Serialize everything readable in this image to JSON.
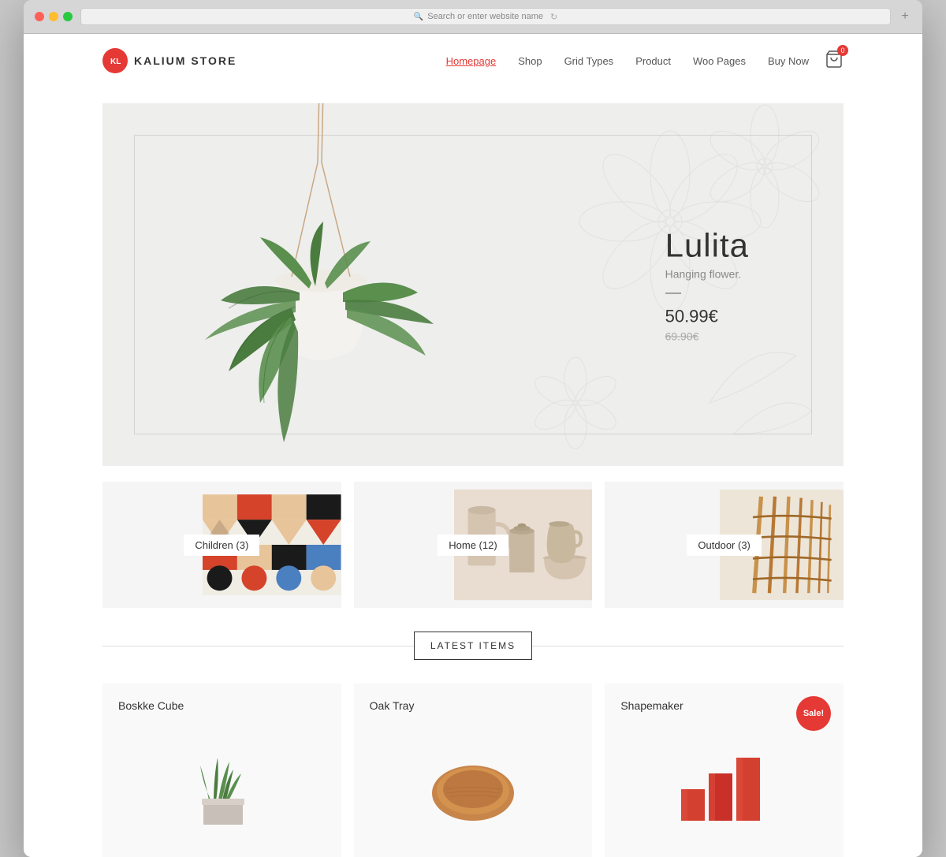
{
  "browser": {
    "address_placeholder": "Search or enter website name",
    "new_tab_label": "+"
  },
  "header": {
    "logo_text": "KALIUM STORE",
    "logo_initials": "KL",
    "nav": [
      {
        "label": "Homepage",
        "active": true
      },
      {
        "label": "Shop",
        "active": false
      },
      {
        "label": "Grid Types",
        "active": false
      },
      {
        "label": "Product",
        "active": false
      },
      {
        "label": "Woo Pages",
        "active": false
      },
      {
        "label": "Buy Now",
        "active": false
      }
    ],
    "cart_count": "0"
  },
  "hero": {
    "product_name": "Lulita",
    "product_subtitle": "Hanging flower.",
    "price": "50.99€",
    "price_old": "69.90€"
  },
  "categories": [
    {
      "label": "Children (3)",
      "type": "children"
    },
    {
      "label": "Home (12)",
      "type": "home"
    },
    {
      "label": "Outdoor (3)",
      "type": "outdoor"
    }
  ],
  "latest_section": {
    "title": "LATEST ITEMS"
  },
  "products": [
    {
      "name": "Boskke Cube",
      "sale": false
    },
    {
      "name": "Oak Tray",
      "sale": false
    },
    {
      "name": "Shapemaker",
      "sale": true,
      "sale_label": "Sale!"
    }
  ]
}
